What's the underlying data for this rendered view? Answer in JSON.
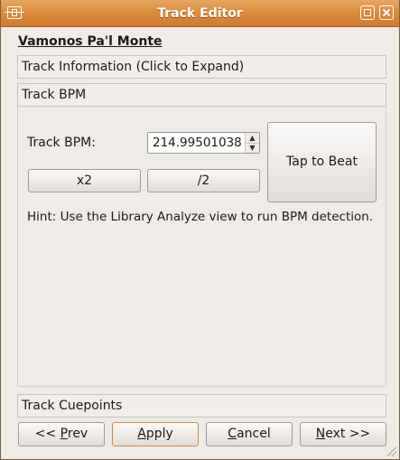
{
  "window": {
    "title": "Track Editor"
  },
  "track": {
    "title": "Vamonos Pa'l Monte"
  },
  "sections": {
    "info": "Track Information (Click to Expand)",
    "bpm": "Track BPM",
    "cuepoints": "Track Cuepoints"
  },
  "bpm": {
    "label": "Track BPM:",
    "value": "214.99501038",
    "double_label": "x2",
    "half_label": "/2",
    "tap_label": "Tap to Beat",
    "hint": "Hint: Use the Library Analyze view to run BPM detection."
  },
  "footer": {
    "prev": {
      "pre": "<< ",
      "mnemonic": "P",
      "post": "rev"
    },
    "apply": {
      "pre": "",
      "mnemonic": "A",
      "post": "pply"
    },
    "cancel": {
      "pre": "",
      "mnemonic": "C",
      "post": "ancel"
    },
    "next": {
      "pre": "",
      "mnemonic": "N",
      "post": "ext >>"
    }
  },
  "colors": {
    "titlebar": "#dc8d3e",
    "background": "#efebe7",
    "default_button_border": "#d28a3e"
  },
  "icons": {
    "window": "app-window-icon",
    "maximize": "maximize-icon",
    "close": "close-icon",
    "spin_up": "arrow-up-icon",
    "spin_down": "arrow-down-icon"
  }
}
